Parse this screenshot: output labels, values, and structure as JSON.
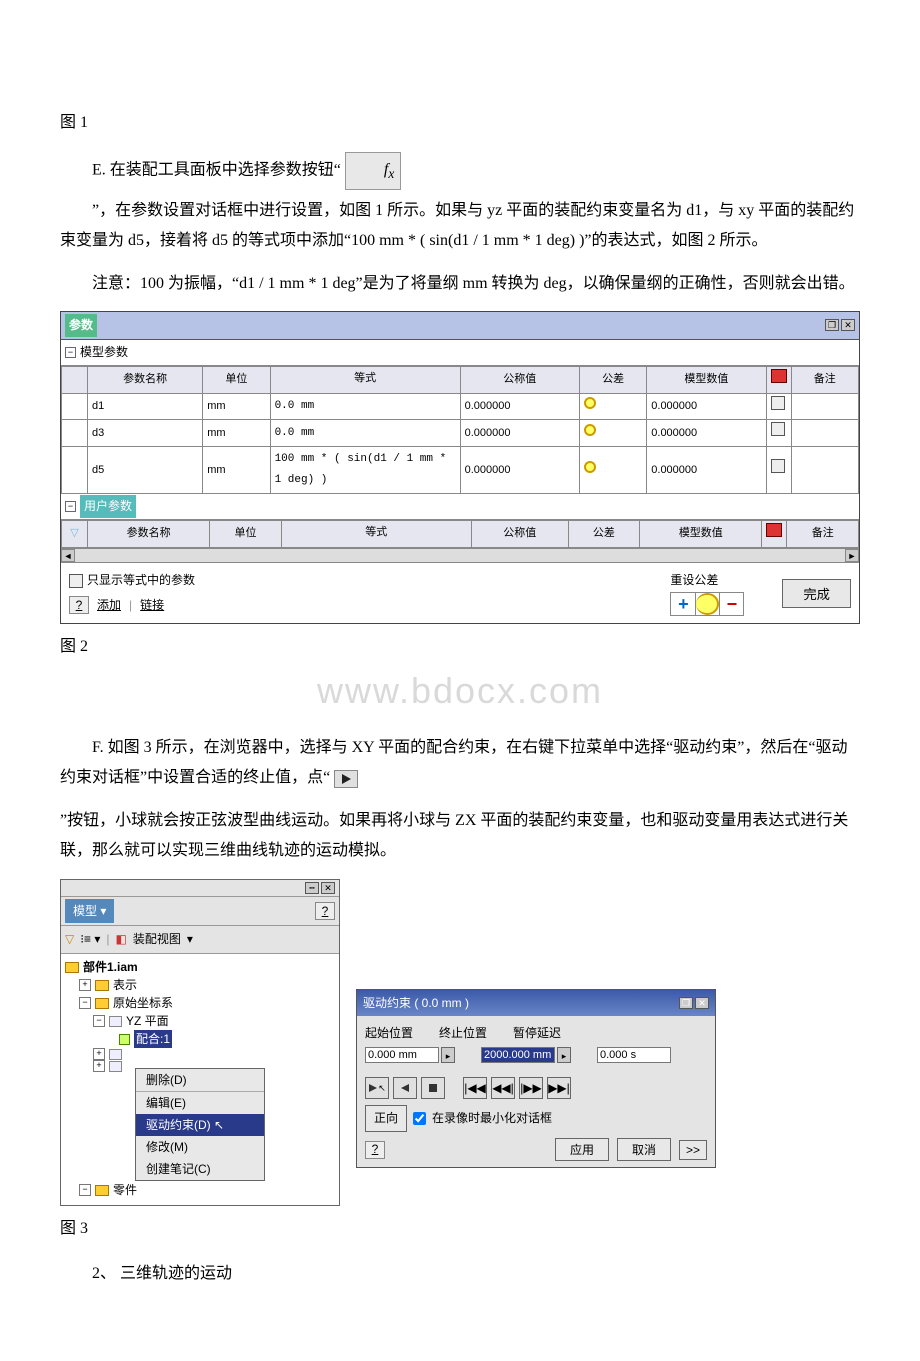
{
  "labels": {
    "fig1": "图 1",
    "fig2": "图 2",
    "fig3": "图 3"
  },
  "para_e_prefix": "E. 在装配工具面板中选择参数按钮“",
  "fx_icon": "f x",
  "para_e_continue": "”，在参数设置对话框中进行设置，如图 1 所示。如果与 yz 平面的装配约束变量名为 d1，与 xy 平面的装配约束变量为 d5，接着将 d5 的等式项中添加“100 mm * ( sin(d1 / 1 mm * 1 deg) )”的表达式，如图 2 所示。",
  "para_note": "注意：100 为振幅，“d1 / 1 mm * 1 deg”是为了将量纲 mm 转换为 deg，以确保量纲的正确性，否则就会出错。",
  "para_f_prefix": "F. 如图 3 所示，在浏览器中，选择与 XY 平面的配合约束，在右键下拉菜单中选择“驱动约束”，然后在“驱动约束对话框”中设置合适的终止值，点“",
  "para_f_continue": "”按钮，小球就会按正弦波型曲线运动。如果再将小球与 ZX 平面的装配约束变量，也和驱动变量用表达式进行关联，那么就可以实现三维曲线轨迹的运动模拟。",
  "section2": "2、 三维轨迹的运动",
  "watermark": "www.bdocx.com",
  "fig2data": {
    "title": "参数",
    "group_model": "模型参数",
    "group_user": "用户参数",
    "headers": {
      "name": "参数名称",
      "unit": "单位",
      "eq": "等式",
      "nominal": "公称值",
      "tol": "公差",
      "model_val": "模型数值",
      "note": "备注"
    },
    "rows": [
      {
        "name": "d1",
        "unit": "mm",
        "eq": "0.0 mm",
        "nominal": "0.000000",
        "model_val": "0.000000"
      },
      {
        "name": "d3",
        "unit": "mm",
        "eq": "0.0 mm",
        "nominal": "0.000000",
        "model_val": "0.000000"
      },
      {
        "name": "d5",
        "unit": "mm",
        "eq": "100 mm * ( sin(d1 / 1 mm * 1 deg) )",
        "nominal": "0.000000",
        "model_val": "0.000000"
      }
    ],
    "chk_show_eq": "只显示等式中的参数",
    "btn_add": "添加",
    "btn_link": "链接",
    "reset_tol": "重设公差",
    "btn_done": "完成"
  },
  "fig3data": {
    "browser": {
      "model_dropdown": "模型 ▾",
      "help": "?",
      "asm_view": "装配视图",
      "root": "部件1.iam",
      "node_repr": "表示",
      "node_origin": "原始坐标系",
      "node_yz": "YZ 平面",
      "node_mate": "配合:1",
      "node_part": "零件",
      "ctx": {
        "delete": "删除(D)",
        "edit": "编辑(E)",
        "drive": "驱动约束(D)",
        "modify": "修改(M)",
        "note": "创建笔记(C)"
      }
    },
    "drive": {
      "title": "驱动约束  ( 0.0 mm )",
      "start_lbl": "起始位置",
      "end_lbl": "终止位置",
      "delay_lbl": "暂停延迟",
      "start_val": "0.000 mm",
      "end_val": "2000.000 mm",
      "delay_val": "0.000 s",
      "dir_btn": "正向",
      "chk_min": "在录像时最小化对话框",
      "btn_apply": "应用",
      "btn_cancel": "取消",
      "btn_more": ">>"
    }
  }
}
